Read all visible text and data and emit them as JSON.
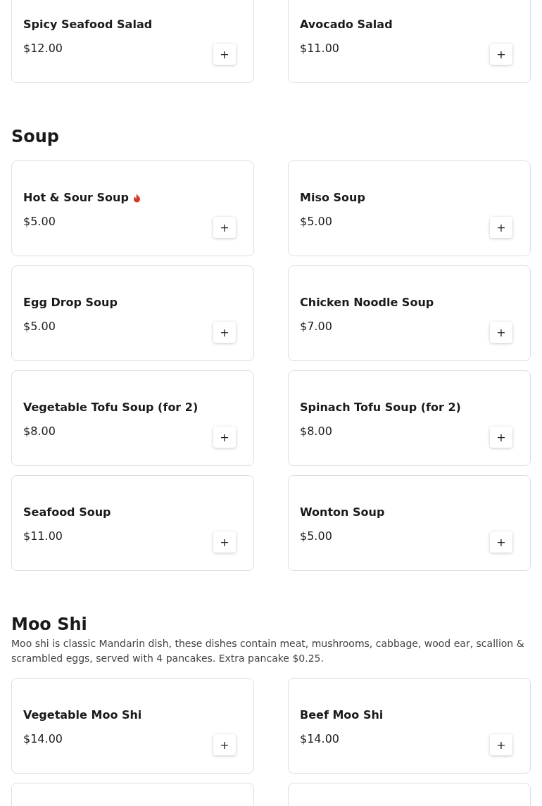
{
  "sections": [
    {
      "items": [
        {
          "kind": "dish",
          "name": "Spicy Seafood Salad",
          "price": "$12.00",
          "spicy": false,
          "add": "+"
        },
        {
          "kind": "dish",
          "name": "Avocado Salad",
          "price": "$11.00",
          "spicy": false,
          "add": "+"
        }
      ]
    },
    {
      "title": "Soup",
      "items": [
        {
          "kind": "dish",
          "name": "Hot & Sour Soup",
          "price": "$5.00",
          "spicy": true,
          "add": "+"
        },
        {
          "kind": "dish",
          "name": "Miso Soup",
          "price": "$5.00",
          "spicy": false,
          "add": "+"
        },
        {
          "kind": "dish",
          "name": "Egg Drop Soup",
          "price": "$5.00",
          "spicy": false,
          "add": "+"
        },
        {
          "kind": "dish",
          "name": "Chicken Noodle Soup",
          "price": "$7.00",
          "spicy": false,
          "add": "+"
        },
        {
          "kind": "dish",
          "name": "Vegetable Tofu Soup (for 2)",
          "price": "$8.00",
          "spicy": false,
          "add": "+"
        },
        {
          "kind": "dish",
          "name": "Spinach Tofu Soup (for 2)",
          "price": "$8.00",
          "spicy": false,
          "add": "+"
        },
        {
          "kind": "dish",
          "name": "Seafood Soup",
          "price": "$11.00",
          "spicy": false,
          "add": "+"
        },
        {
          "kind": "dish",
          "name": "Wonton Soup",
          "price": "$5.00",
          "spicy": false,
          "add": "+"
        }
      ]
    },
    {
      "title": "Moo Shi",
      "description": "Moo shi is classic Mandarin dish, these dishes contain meat, mushrooms, cabbage, wood ear, scallion & scrambled eggs, served with 4 pancakes. Extra pancake $0.25.",
      "items": [
        {
          "kind": "dish",
          "name": "Vegetable Moo Shi",
          "price": "$14.00",
          "spicy": false,
          "add": "+"
        },
        {
          "kind": "dish",
          "name": "Beef Moo Shi",
          "price": "$14.00",
          "spicy": false,
          "add": "+"
        },
        {
          "kind": "cut"
        },
        {
          "kind": "cut"
        }
      ]
    }
  ]
}
